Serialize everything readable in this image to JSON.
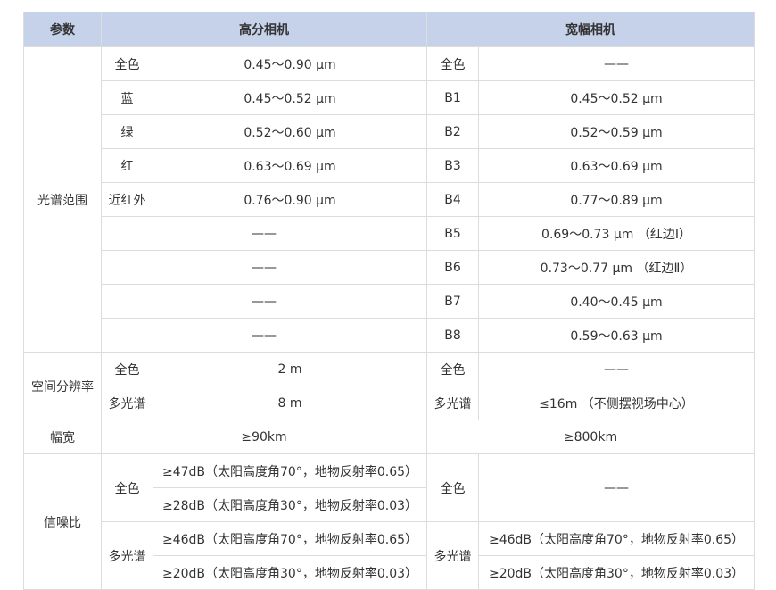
{
  "header": {
    "param": "参数",
    "hr_camera": "高分相机",
    "wf_camera": "宽幅相机"
  },
  "spectral": {
    "label": "光谱范围",
    "rows": [
      {
        "hr_band": "全色",
        "hr_value": "0.45～0.90 μm",
        "wf_band": "全色",
        "wf_value": "——"
      },
      {
        "hr_band": "蓝",
        "hr_value": "0.45～0.52 μm",
        "wf_band": "B1",
        "wf_value": "0.45～0.52 μm"
      },
      {
        "hr_band": "绿",
        "hr_value": "0.52～0.60 μm",
        "wf_band": "B2",
        "wf_value": "0.52～0.59 μm"
      },
      {
        "hr_band": "红",
        "hr_value": "0.63～0.69 μm",
        "wf_band": "B3",
        "wf_value": "0.63～0.69 μm"
      },
      {
        "hr_band": "近红外",
        "hr_value": "0.76～0.90 μm",
        "wf_band": "B4",
        "wf_value": "0.77～0.89 μm"
      }
    ],
    "extra_rows": [
      {
        "hr_value": "——",
        "wf_band": "B5",
        "wf_value": "0.69～0.73 μm （红边Ⅰ）"
      },
      {
        "hr_value": "——",
        "wf_band": "B6",
        "wf_value": "0.73～0.77 μm （红边Ⅱ）"
      },
      {
        "hr_value": "——",
        "wf_band": "B7",
        "wf_value": "0.40～0.45 μm"
      },
      {
        "hr_value": "——",
        "wf_band": "B8",
        "wf_value": "0.59～0.63 μm"
      }
    ]
  },
  "resolution": {
    "label": "空间分辨率",
    "pan": {
      "hr_band": "全色",
      "hr_value": "2 m",
      "wf_band": "全色",
      "wf_value": "——"
    },
    "ms": {
      "hr_band": "多光谱",
      "hr_value": "8 m",
      "wf_band": "多光谱",
      "wf_value": "≤16m （不侧摆视场中心）"
    }
  },
  "swath": {
    "label": "幅宽",
    "hr_value": "≥90km",
    "wf_value": "≥800km"
  },
  "snr": {
    "label": "信噪比",
    "pan": {
      "hr_band": "全色",
      "hr_values": [
        "≥47dB（太阳高度角70°，地物反射率0.65）",
        "≥28dB（太阳高度角30°，地物反射率0.03）"
      ],
      "wf_band": "全色",
      "wf_value": "——"
    },
    "ms": {
      "hr_band": "多光谱",
      "hr_values": [
        "≥46dB（太阳高度角70°，地物反射率0.65）",
        "≥20dB（太阳高度角30°，地物反射率0.03）"
      ],
      "wf_band": "多光谱",
      "wf_values": [
        "≥46dB（太阳高度角70°，地物反射率0.65）",
        "≥20dB（太阳高度角30°，地物反射率0.03）"
      ]
    }
  }
}
